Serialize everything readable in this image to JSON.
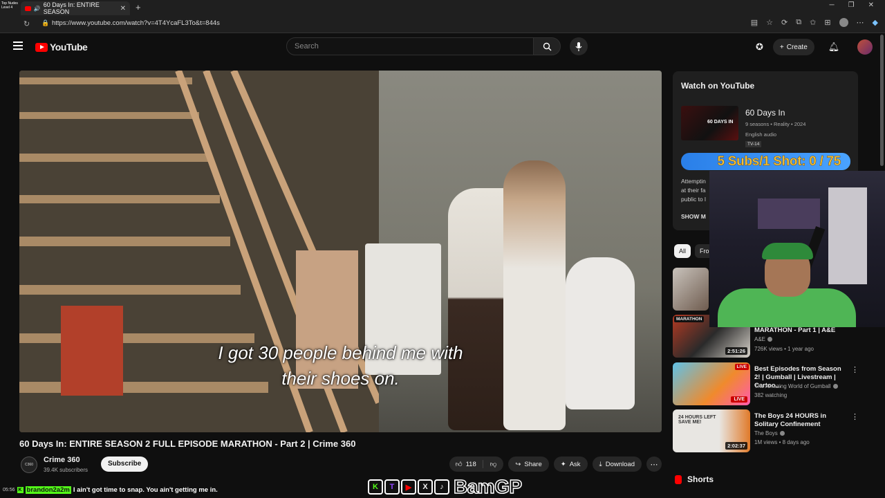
{
  "browser": {
    "tab_title": "60 Days In: ENTIRE SEASON",
    "url": "https://www.youtube.com/watch?v=4T4YcaFL3To&t=844s",
    "overlay_lines": [
      "Top Nudes",
      "Level 4"
    ]
  },
  "header": {
    "logo_text": "YouTube",
    "search_placeholder": "Search",
    "create_label": "Create"
  },
  "player": {
    "subtitle_line1": "I got 30 people behind me with",
    "subtitle_line2": "their shoes on."
  },
  "video": {
    "title": "60 Days In: ENTIRE SEASON 2 FULL EPISODE MARATHON - Part 2 | Crime 360",
    "channel": "Crime 360",
    "subscribers": "39.4K subscribers",
    "subscribe_label": "Subscribe",
    "likes": "118",
    "share_label": "Share",
    "ask_label": "Ask",
    "download_label": "Download"
  },
  "watch_card": {
    "heading": "Watch on YouTube",
    "show_title": "60 Days In",
    "meta": "9 seasons • Reality • 2024",
    "audio": "English audio",
    "rating": "TV-14",
    "thumb_text": "60 DAYS IN",
    "desc_lines": [
      "Attemptin",
      "at their fa",
      "public to l"
    ],
    "show_more": "SHOW M"
  },
  "stream_overlay": {
    "sub_goal": "5 Subs/1 Shot:  0 / 75",
    "chat_time": "05:56",
    "chat_user": "brandon2a2m",
    "chat_message": "I ain't got time to snap. You ain't getting me in.",
    "brand_name": "BamGP",
    "brand_icons": [
      "K",
      "T",
      "▶",
      "X",
      "♪"
    ]
  },
  "chips": [
    "All",
    "Fro"
  ],
  "recommendations": [
    {
      "title": "",
      "channel": "",
      "views": "",
      "duration": "",
      "badge": "MARATHON"
    },
    {
      "title": "MARATHON - Part 1 | A&E",
      "channel": "A&E",
      "views": "726K views • 1 year ago",
      "duration": "2:51:26"
    },
    {
      "title": "Best Episodes from Season 2! | Gumball | Livestream | Cartoo...",
      "channel": "The Amazing World of Gumball",
      "views": "382 watching",
      "live": "LIVE"
    },
    {
      "title": "The Boys 24 HOURS in Solitary Confinement",
      "channel": "The Boys",
      "views": "1M views • 8 days ago",
      "duration": "2:02:37",
      "thumb_text": "24 HOURS LEFT SAVE ME!"
    }
  ],
  "shorts_label": "Shorts"
}
